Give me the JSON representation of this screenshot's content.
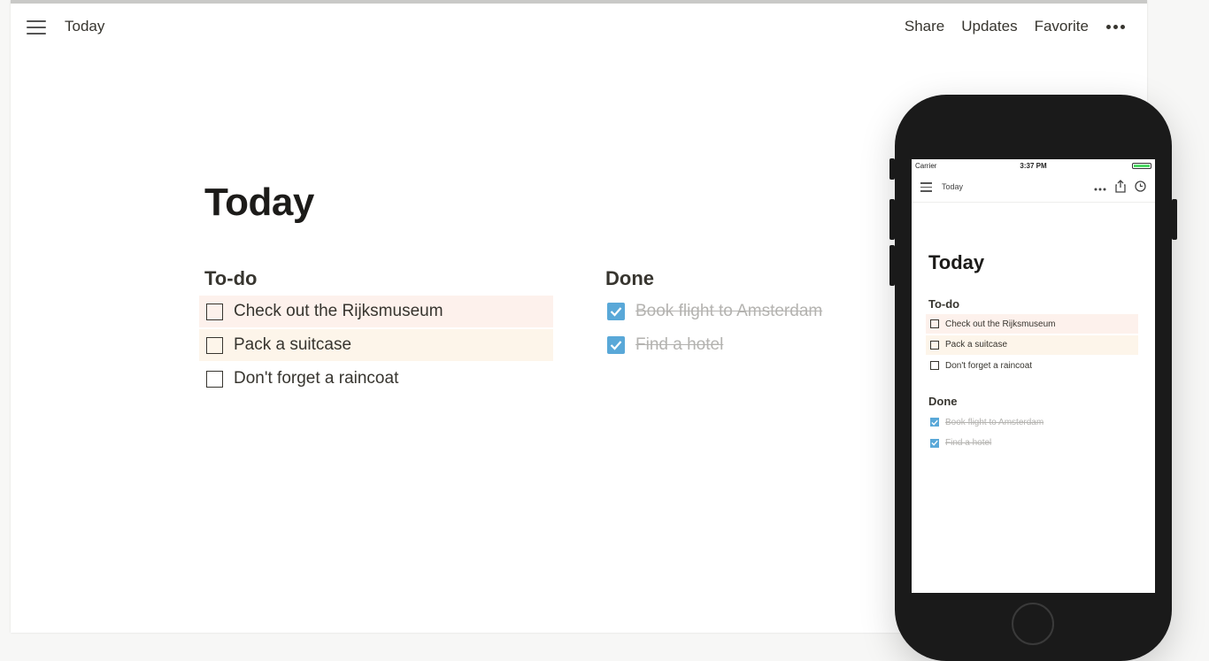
{
  "topbar": {
    "breadcrumb": "Today",
    "actions": [
      "Share",
      "Updates",
      "Favorite"
    ],
    "more_icon": "more-horizontal-icon",
    "menu_icon": "hamburger-menu-icon"
  },
  "page": {
    "title": "Today",
    "todo": {
      "heading": "To-do",
      "items": [
        "Check out the Rijksmuseum",
        "Pack a suitcase",
        "Don't forget a raincoat"
      ]
    },
    "done": {
      "heading": "Done",
      "items": [
        "Book flight to Amsterdam",
        "Find a hotel"
      ]
    }
  },
  "phone": {
    "status": {
      "carrier": "Carrier",
      "time": "3:37 PM"
    },
    "breadcrumb": "Today",
    "title": "Today",
    "todo_heading": "To-do",
    "todo_items": [
      "Check out the Rijksmuseum",
      "Pack a suitcase",
      "Don't forget a raincoat"
    ],
    "done_heading": "Done",
    "done_items": [
      "Book flight to Amsterdam",
      "Find a hotel"
    ]
  },
  "colors": {
    "check_blue": "#59a8d8",
    "highlight_pink": "#fdf1ec",
    "highlight_orange": "#fdf5ea",
    "battery_green": "#4cd964"
  }
}
